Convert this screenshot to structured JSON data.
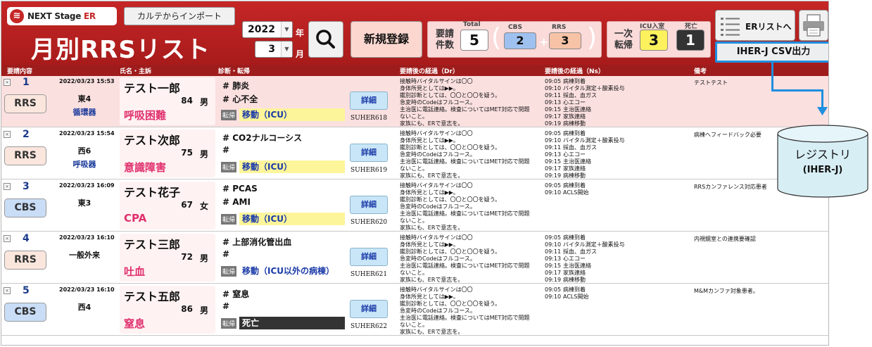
{
  "header": {
    "logo_main": "NEXT Stage ",
    "logo_accent": "ER",
    "import_button": "カルテからインポート",
    "title": "月別RRSリスト",
    "year": "2022",
    "year_unit": "年",
    "month": "3",
    "month_unit": "月",
    "new_button": "新規登録",
    "request_label_line1": "要請",
    "request_label_line2": "件数",
    "total_caption": "Total",
    "total_value": "5",
    "cbs_caption": "CBS",
    "cbs_value": "2",
    "rrs_caption": "RRS",
    "rrs_value": "3",
    "plus": "+",
    "paren_open": "(",
    "paren_close": ")",
    "disp_label_line1": "一次",
    "disp_label_line2": "転帰",
    "icu_caption": "ICU入室",
    "icu_value": "3",
    "death_caption": "死亡",
    "death_value": "1",
    "erlist_button": "ERリストへ",
    "csv_button": "IHER-J CSV出力"
  },
  "columns": {
    "request": "要請内容",
    "name": "氏名・主訴",
    "diagnosis": "診断・転帰",
    "dr_course": "要請後の経過（Dr）",
    "ns_course": "要請後の経過（Ns）",
    "remark": "備考"
  },
  "detail_label": "詳細",
  "disposition_label": "転帰",
  "hash": "#",
  "rows": [
    {
      "no": "1",
      "type": "RRS",
      "datetime": "2022/03/23 15:53",
      "ward": "東4",
      "dept": "循環器",
      "name": "テスト一郎",
      "age": "84",
      "sex": "男",
      "complaint": "呼吸困難",
      "dx1": "肺炎",
      "dx2": "心不全",
      "disposition": "移動（ICU）",
      "suher": "SUHER618",
      "dr": [
        "接触時バイタルサインは〇〇",
        "身体所見としては▶▶。",
        "鑑別診断としては、〇〇と〇〇を疑う。",
        "急変時のCodeはフルコース。",
        "主治医に電話連絡。検査についてはMET対応で問題",
        "ないこと。",
        "家族にも、ERで意志を。"
      ],
      "ns": [
        [
          "09:05",
          "病棟到着"
        ],
        [
          "09:10",
          "バイタル測定＋酸素投与"
        ],
        [
          "09:11",
          "採血、血ガス"
        ],
        [
          "09:13",
          "心エコー"
        ],
        [
          "09:15",
          "主治医連絡"
        ],
        [
          "09:17",
          "家族連絡"
        ],
        [
          "09:19",
          "病棟移動"
        ]
      ],
      "remark": "テストテスト"
    },
    {
      "no": "2",
      "type": "RRS",
      "datetime": "2022/03/23 15:54",
      "ward": "西6",
      "dept": "呼吸器",
      "name": "テスト次郎",
      "age": "75",
      "sex": "男",
      "complaint": "意識障害",
      "dx1": "CO2ナルコーシス",
      "dx2": "",
      "disposition": "移動（ICU）",
      "suher": "SUHER619",
      "dr": [
        "接触時バイタルサインは〇〇",
        "身体所見としては▶▶。",
        "鑑別診断としては、〇〇と〇〇を疑う。",
        "急変時のCodeはフルコース。",
        "主治医に電話連絡。検査についてはMET対応で問題",
        "ないこと。",
        "家族にも、ERで意志を。"
      ],
      "ns": [
        [
          "09:05",
          "病棟到着"
        ],
        [
          "09:10",
          "バイタル測定＋酸素投与"
        ],
        [
          "09:11",
          "採血、血ガス"
        ],
        [
          "09:13",
          "心エコー"
        ],
        [
          "09:15",
          "主治医連絡"
        ],
        [
          "09:17",
          "家族連絡"
        ],
        [
          "09:19",
          "病棟移動"
        ]
      ],
      "remark": "病棟へフィードバック必要"
    },
    {
      "no": "3",
      "type": "CBS",
      "datetime": "2022/03/23 16:09",
      "ward": "東3",
      "dept": "",
      "name": "テスト花子",
      "age": "67",
      "sex": "女",
      "complaint": "CPA",
      "dx1": "PCAS",
      "dx2": "AMI",
      "disposition": "移動（ICU）",
      "suher": "SUHER620",
      "dr": [
        "接触時バイタルサインは〇〇",
        "身体所見としては▶▶。",
        "鑑別診断としては、〇〇と〇〇を疑う。",
        "急変時のCodeはフルコース。",
        "主治医に電話連絡。検査についてはMET対応で問題",
        "ないこと。",
        "家族にも、ERで意志を。"
      ],
      "ns": [
        [
          "09:05",
          "病棟到着"
        ],
        [
          "09:10",
          "ACLS開始"
        ]
      ],
      "remark": "RRSカンファレンス対応患者"
    },
    {
      "no": "4",
      "type": "RRS",
      "datetime": "2022/03/23 16:10",
      "ward": "一般外来",
      "dept": "",
      "name": "テスト三郎",
      "age": "72",
      "sex": "男",
      "complaint": "吐血",
      "dx1": "上部消化管出血",
      "dx2": "",
      "disposition": "移動（ICU以外の病棟）",
      "suher": "SUHER621",
      "dr": [
        "接触時バイタルサインは〇〇",
        "身体所見としては▶▶。",
        "鑑別診断としては、〇〇と〇〇を疑う。",
        "急変時のCodeはフルコース。",
        "主治医に電話連絡。検査についてはMET対応で問題",
        "ないこと。",
        "家族にも、ERで意志を。"
      ],
      "ns": [
        [
          "09:05",
          "病棟到着"
        ],
        [
          "09:10",
          "バイタル測定＋酸素投与"
        ],
        [
          "09:11",
          "採血、血ガス"
        ],
        [
          "09:13",
          "心エコー"
        ],
        [
          "09:15",
          "主治医連絡"
        ],
        [
          "09:17",
          "家族連絡"
        ],
        [
          "09:19",
          "病棟移動"
        ]
      ],
      "remark": "内視鏡室との連携要確認"
    },
    {
      "no": "5",
      "type": "CBS",
      "datetime": "2022/03/23 16:10",
      "ward": "西4",
      "dept": "",
      "name": "テスト五郎",
      "age": "86",
      "sex": "男",
      "complaint": "窒息",
      "dx1": "窒息",
      "dx2": "",
      "disposition": "死亡",
      "suher": "SUHER622",
      "dr": [
        "接触時バイタルサインは〇〇",
        "身体所見としては▶▶。",
        "鑑別診断としては、〇〇と〇〇を疑う。",
        "急変時のCodeはフルコース。",
        "主治医に電話連絡。検査についてはMET対応で問題",
        "ないこと。",
        "家族にも、ERで意志を。"
      ],
      "ns": [
        [
          "09:05",
          "病棟到着"
        ],
        [
          "09:10",
          "ACLS開始"
        ]
      ],
      "remark": "M&Mカンファ対象患者。"
    }
  ],
  "registry": {
    "label": "レジストリ",
    "sublabel": "(IHER-J)"
  },
  "colors": {
    "header_red": "#c62626",
    "selected_row": "#fbe0e0",
    "rrs_tag": "#fbe6dd",
    "cbs_tag": "#c9ddf7",
    "complaint_pink": "#e0306e",
    "highlight_blue": "#1f8fe0",
    "registry_fill": "#d7eef4"
  },
  "icons": {
    "search": "magnifier-icon",
    "erlist": "list-icon",
    "printer": "printer-icon",
    "registry": "database-cylinder-icon"
  }
}
